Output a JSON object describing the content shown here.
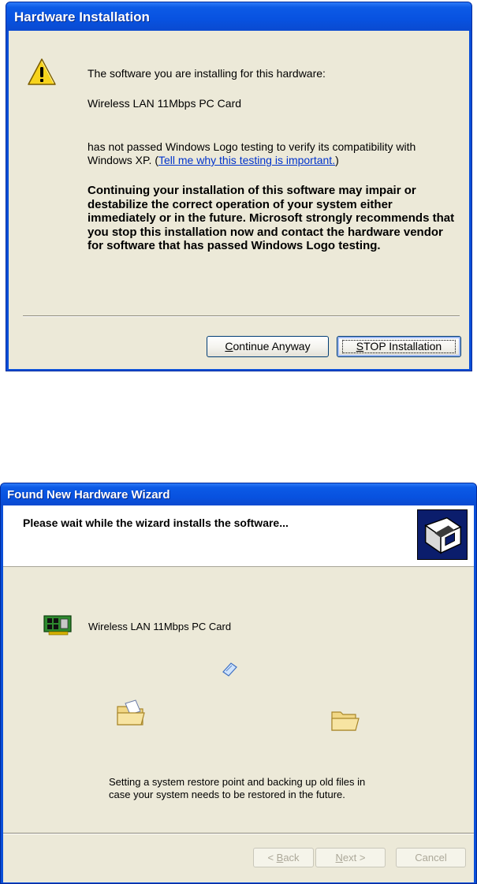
{
  "hardware_installation": {
    "title": "Hardware Installation",
    "intro": "The software you are installing for this hardware:",
    "device_name": "Wireless LAN 11Mbps PC Card",
    "body_text": "has not passed Windows Logo testing to verify its compatibility with Windows XP. (",
    "link_text": "Tell me why this testing is important.",
    "body_close": ")",
    "warning_text": "Continuing your installation of this software may impair or destabilize the correct operation of your system either immediately or in the future. Microsoft strongly recommends that you stop this installation now and contact the hardware vendor for software that has passed Windows Logo testing.",
    "continue_button": {
      "mnemonic": "C",
      "rest": "ontinue Anyway"
    },
    "stop_button": {
      "mnemonic": "S",
      "rest": "TOP Installation"
    },
    "icon": "warning-icon"
  },
  "found_new_hardware_wizard": {
    "title": "Found New Hardware Wizard",
    "heading": "Please wait while the wizard installs the software...",
    "device_name": "Wireless LAN 11Mbps PC Card",
    "status_text": "Setting a system restore point and backing up old files in case your system needs to be restored in the future.",
    "back_button": {
      "prefix": "< ",
      "mnemonic": "B",
      "rest": "ack"
    },
    "next_button": {
      "mnemonic": "N",
      "rest": "ext >"
    },
    "cancel_button": "Cancel",
    "icons": [
      "wizard-logo-icon",
      "pc-card-icon",
      "source-folder-icon",
      "flying-document-icon",
      "destination-folder-icon"
    ]
  },
  "colors": {
    "titlebar": "#0a4fd8",
    "dialog_face": "#ece9d8",
    "link": "#0033cc",
    "disabled_text": "#aca899"
  }
}
